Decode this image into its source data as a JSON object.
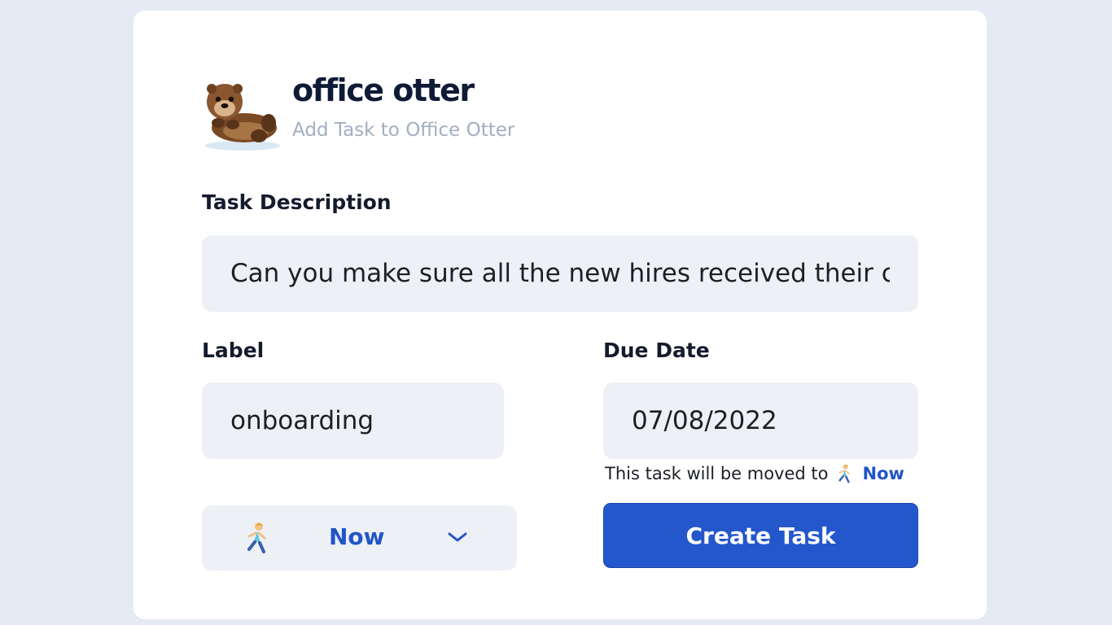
{
  "app": {
    "name": "office otter",
    "subtitle": "Add Task to Office Otter",
    "logo_icon": "otter-icon"
  },
  "form": {
    "description": {
      "label": "Task Description",
      "value": "Can you make sure all the new hires received their c"
    },
    "label_field": {
      "label": "Label",
      "value": "onboarding"
    },
    "due_date": {
      "label": "Due Date",
      "value": "07/08/2022"
    },
    "move_hint": {
      "text": "This task will be moved to",
      "icon": "runner-icon",
      "status": "Now"
    },
    "status_select": {
      "icon": "runner-icon",
      "selected": "Now",
      "chevron_icon": "chevron-down-icon"
    },
    "submit_label": "Create Task"
  },
  "colors": {
    "page_background": "#e5eaf4",
    "accent": "#2557cc",
    "field_background": "#edf0f5",
    "subtitle": "#a3aec2"
  }
}
